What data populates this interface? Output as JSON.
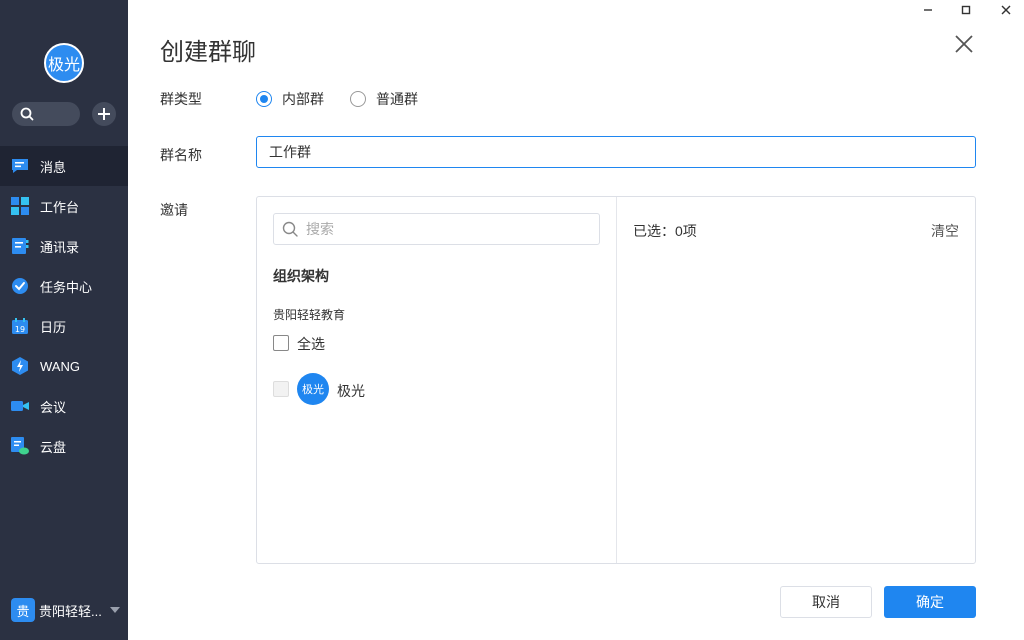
{
  "sidebar": {
    "avatar_text": "极光",
    "nav": [
      {
        "label": "消息",
        "icon": "message-icon",
        "active": true
      },
      {
        "label": "工作台",
        "icon": "workbench-icon"
      },
      {
        "label": "通讯录",
        "icon": "contacts-icon"
      },
      {
        "label": "任务中心",
        "icon": "task-icon"
      },
      {
        "label": "日历",
        "icon": "calendar-icon"
      },
      {
        "label": "WANG",
        "icon": "wang-icon"
      },
      {
        "label": "会议",
        "icon": "meeting-icon"
      },
      {
        "label": "云盘",
        "icon": "cloud-drive-icon"
      }
    ],
    "org_badge": "贵",
    "org_label": "贵阳轻轻..."
  },
  "dialog": {
    "title": "创建群聊",
    "group_type_label": "群类型",
    "type_internal": "内部群",
    "type_normal": "普通群",
    "group_name_label": "群名称",
    "group_name_value": "工作群",
    "invite_label": "邀请",
    "search_placeholder": "搜索",
    "org_section_title": "组织架构",
    "org_name": "贵阳轻轻教育",
    "select_all": "全选",
    "member_avatar": "极光",
    "member_name": "极光",
    "selected_count": "已选：0项",
    "clear": "清空",
    "cancel": "取消",
    "confirm": "确定"
  },
  "colors": {
    "sidebar_bg": "#2b3142",
    "accent": "#1f86f0"
  }
}
